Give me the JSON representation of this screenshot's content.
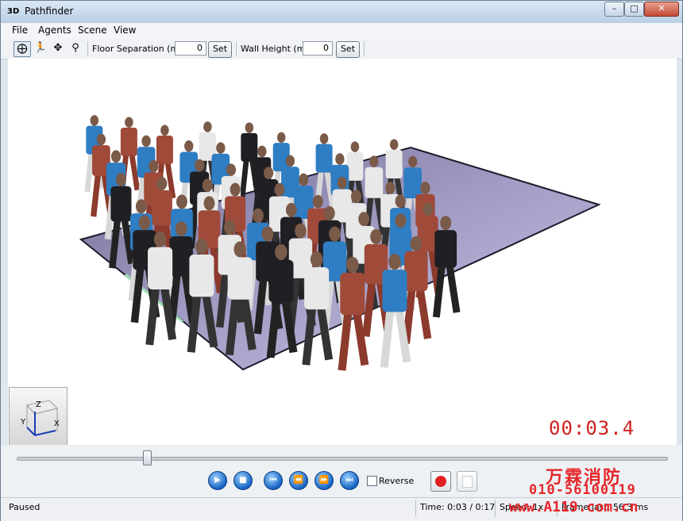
{
  "window": {
    "app_icon": "3D",
    "title": "Pathfinder",
    "controls": [
      "minimize-icon",
      "maximize-icon",
      "close-icon"
    ]
  },
  "menu": [
    "File",
    "Agents",
    "Scene",
    "View"
  ],
  "toolbar": {
    "tools": [
      "orbit-icon",
      "walk-icon",
      "pan-icon",
      "zoom-icon"
    ],
    "floor_separation_label": "Floor Separation (m):",
    "floor_separation_value": "0",
    "floor_set_label": "Set",
    "wall_height_label": "Wall Height (m):",
    "wall_height_value": "0",
    "wall_set_label": "Set"
  },
  "viewport": {
    "timer": "00:03.4",
    "axis_labels": {
      "z": "Z",
      "y": "Y",
      "x": "X"
    }
  },
  "playback": {
    "progress": 0.2,
    "buttons": [
      "play-icon",
      "stop-icon",
      "skip-to-start-icon",
      "rewind-icon",
      "fast-forward-icon",
      "skip-to-end-icon"
    ],
    "reverse_label": "Reverse",
    "reverse_checked": false,
    "record": "record-icon",
    "stop_record": "stop-record-icon"
  },
  "status": {
    "state": "Paused",
    "time": "Time: 0:03 / 0:17",
    "speed": "Speed: 1x",
    "frame": "Frame last: 56.3 ms"
  },
  "watermark": {
    "line1": "万霖消防",
    "line2": "010-56100119",
    "line3": "www.A119.com.cn"
  },
  "colors": {
    "floor": "#9b97be",
    "shirt_blue": "#2f7dc2",
    "suit_dark": "#1f1f24",
    "suit_red": "#a04a3a",
    "timer": "#d11f1f",
    "watermark": "#e6262a"
  }
}
